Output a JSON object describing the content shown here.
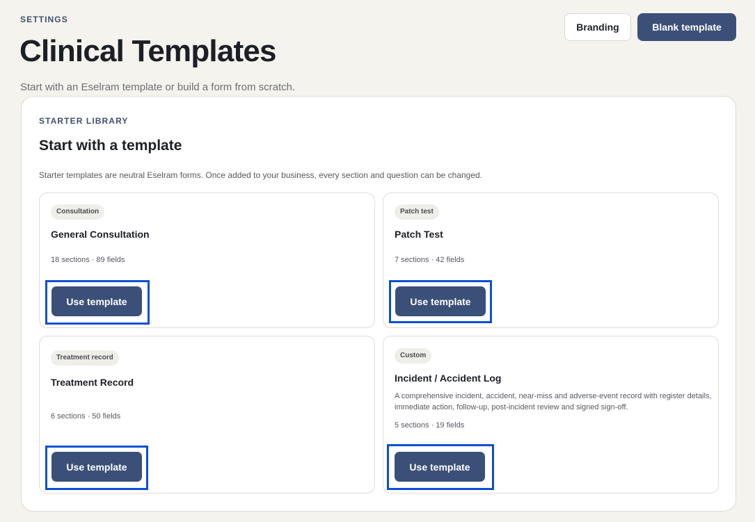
{
  "header": {
    "eyebrow": "SETTINGS",
    "title": "Clinical Templates",
    "subtitle": "Start with an Eselram template or build a form from scratch.",
    "branding_label": "Branding",
    "blank_template_label": "Blank template"
  },
  "library": {
    "eyebrow": "STARTER LIBRARY",
    "title": "Start with a template",
    "description": "Starter templates are neutral Eselram forms. Once added to your business, every section and question can be changed."
  },
  "templates": [
    {
      "category": "Consultation",
      "title": "General Consultation",
      "description": "",
      "meta": "18 sections · 89 fields",
      "button_label": "Use template"
    },
    {
      "category": "Patch test",
      "title": "Patch Test",
      "description": "",
      "meta": "7 sections · 42 fields",
      "button_label": "Use template"
    },
    {
      "category": "Treatment record",
      "title": "Treatment Record",
      "description": "",
      "meta": "6 sections · 50 fields",
      "button_label": "Use template"
    },
    {
      "category": "Custom",
      "title": "Incident / Accident Log",
      "description": "A comprehensive incident, accident, near-miss and adverse-event record with register details, immediate action, follow-up, post-incident review and signed sign-off.",
      "meta": "5 sections · 19 fields",
      "button_label": "Use template"
    }
  ],
  "colors": {
    "background": "#f5f3ee",
    "primary": "#3b5078",
    "highlight": "#0b4fd6"
  }
}
